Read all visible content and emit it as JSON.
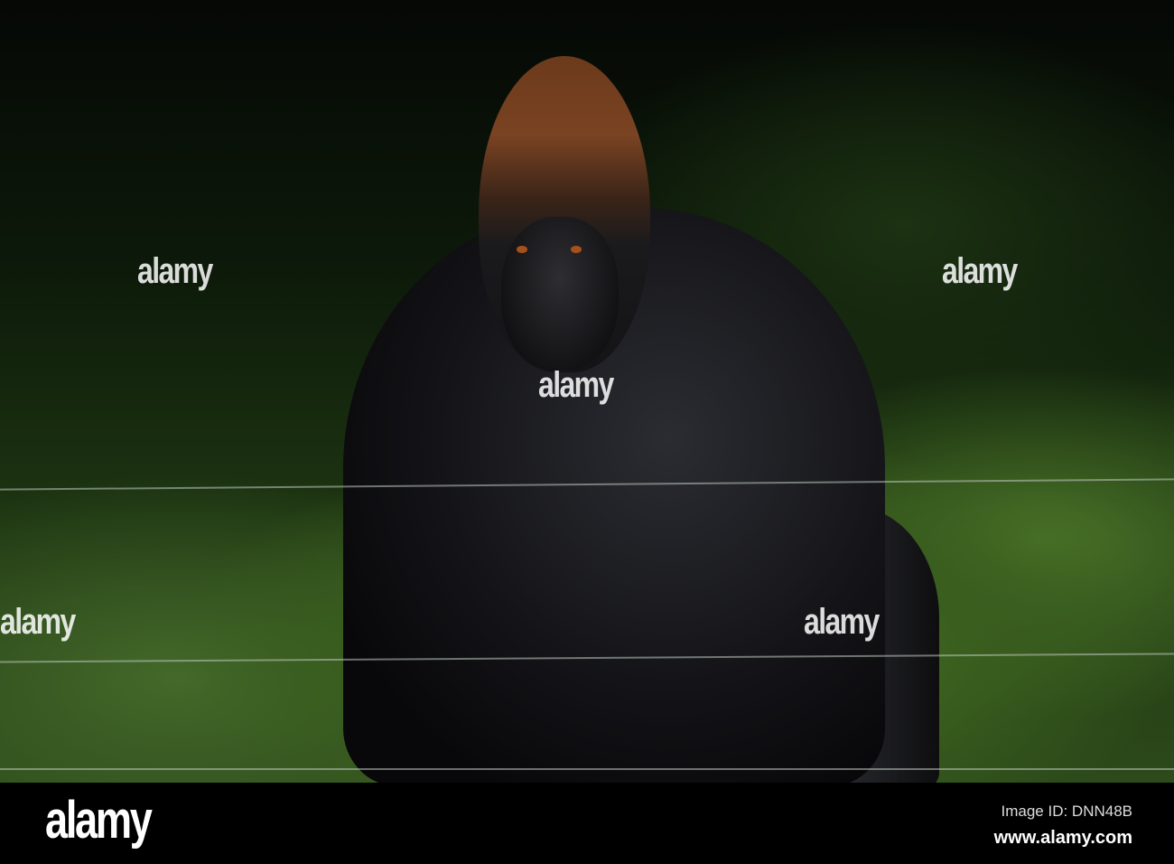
{
  "watermark": {
    "text": "alamy"
  },
  "footer": {
    "logo": "alamy",
    "image_id": "Image ID: DNN48B",
    "url": "www.alamy.com"
  }
}
